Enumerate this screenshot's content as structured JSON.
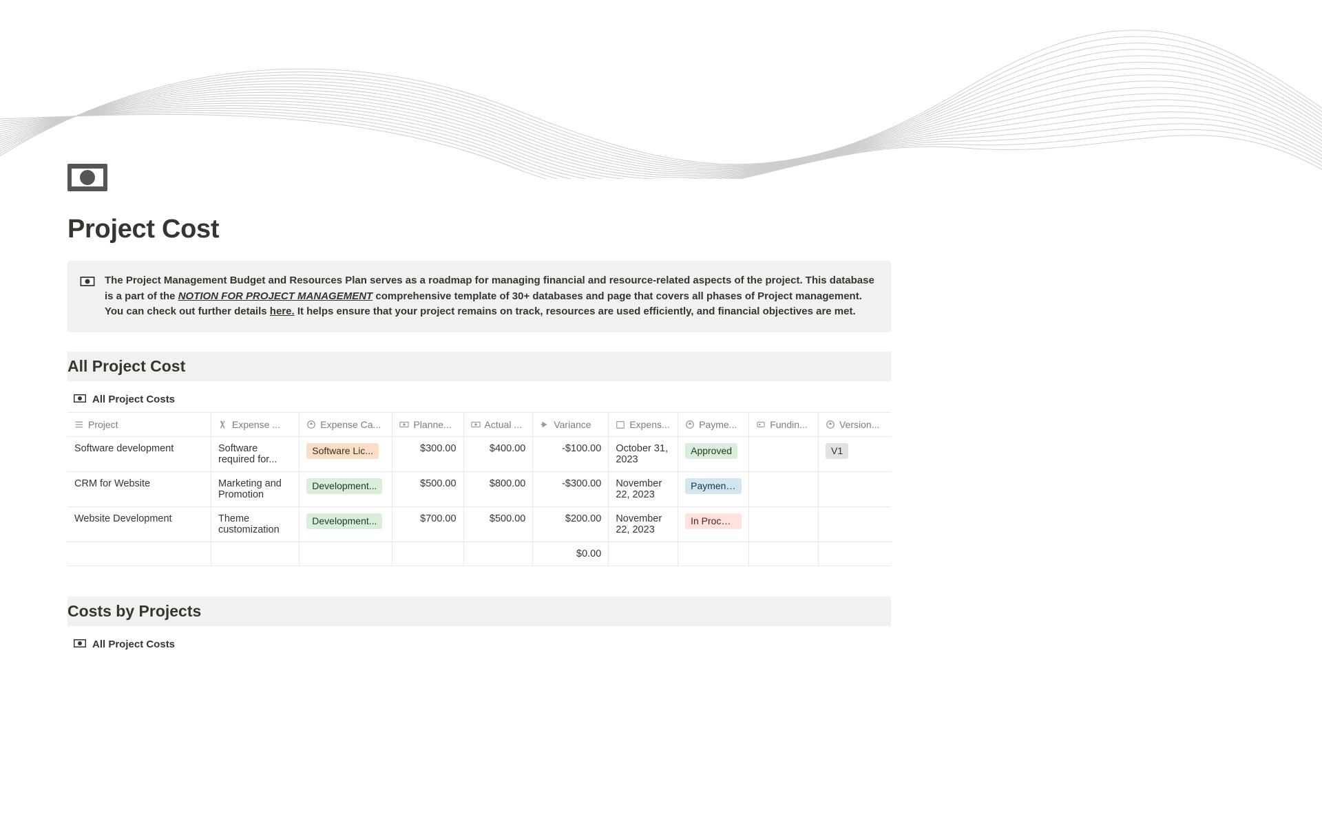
{
  "page": {
    "title": "Project Cost"
  },
  "callout": {
    "text1": "The Project Management Budget and Resources Plan serves as a roadmap for managing financial and resource-related aspects of the project. This  database is a part of the ",
    "link1": "NOTION FOR PROJECT MANAGEMENT",
    "text2": " comprehensive template of 30+ databases and page that covers all phases of Project management. You can check out further details ",
    "link2": "here.",
    "text3": " It helps ensure that your project remains on track, resources are used efficiently, and financial objectives are met."
  },
  "section1": {
    "title": "All Project Cost",
    "view": "All Project Costs"
  },
  "columns": {
    "project": "Project",
    "expenseDesc": "Expense ...",
    "expenseCat": "Expense Ca...",
    "planned": "Planne...",
    "actual": "Actual ...",
    "variance": "Variance",
    "expenseDate": "Expens...",
    "payment": "Payme...",
    "funding": "Fundin...",
    "version": "Version..."
  },
  "rows": [
    {
      "project": "Software development",
      "expenseDesc": "Software required for...",
      "expenseCat": "Software Lic...",
      "catColor": "orange",
      "planned": "$300.00",
      "actual": "$400.00",
      "variance": "-$100.00",
      "date": "October 31, 2023",
      "payment": "Approved",
      "paymentColor": "green",
      "funding": "",
      "version": "V1",
      "versionColor": "gray"
    },
    {
      "project": "CRM for Website",
      "expenseDesc": "Marketing and Promotion",
      "expenseCat": "Development...",
      "catColor": "green",
      "planned": "$500.00",
      "actual": "$800.00",
      "variance": "-$300.00",
      "date": "November 22, 2023",
      "payment": "Payment...",
      "paymentColor": "blue",
      "funding": "",
      "version": "",
      "versionColor": ""
    },
    {
      "project": "Website Development",
      "expenseDesc": "Theme customization",
      "expenseCat": "Development...",
      "catColor": "green",
      "planned": "$700.00",
      "actual": "$500.00",
      "variance": "$200.00",
      "date": "November 22, 2023",
      "payment": "In Process",
      "paymentColor": "red",
      "funding": "",
      "version": "",
      "versionColor": ""
    }
  ],
  "footer": {
    "varianceSum": "$0.00"
  },
  "section2": {
    "title": "Costs by Projects",
    "view": "All Project Costs"
  }
}
